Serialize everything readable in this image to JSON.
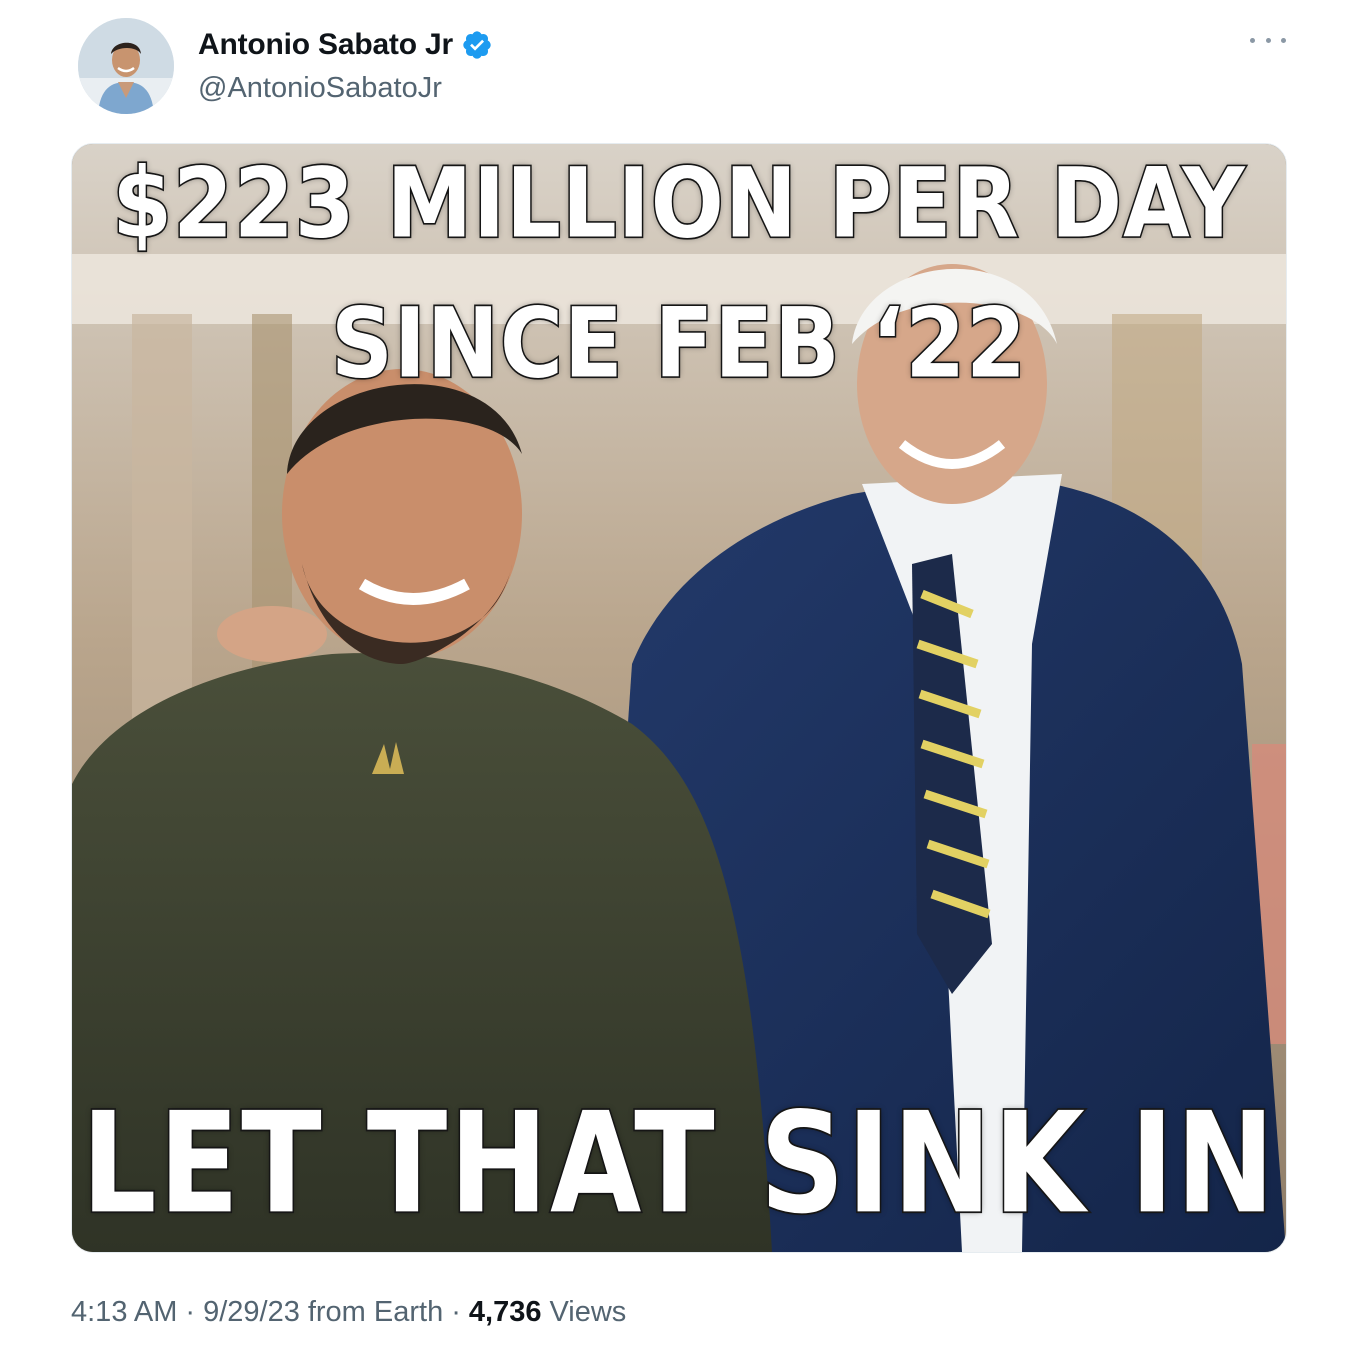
{
  "author": {
    "name": "Antonio Sabato Jr",
    "handle": "@AntonioSabatoJr",
    "verified": true,
    "verified_color": "#1d9bf0",
    "avatar_icon": "profile-photo"
  },
  "more_icon": "ellipsis-icon",
  "media": {
    "top_line_1": "$223 MILLION PER DAY",
    "top_line_2": "SINCE FEB ‘22",
    "bottom_line": "LET THAT SINK IN"
  },
  "meta": {
    "time": "4:13 AM",
    "date": "9/29/23",
    "source": "from Earth",
    "views_count": "4,736",
    "views_label": "Views",
    "separator": "·"
  }
}
